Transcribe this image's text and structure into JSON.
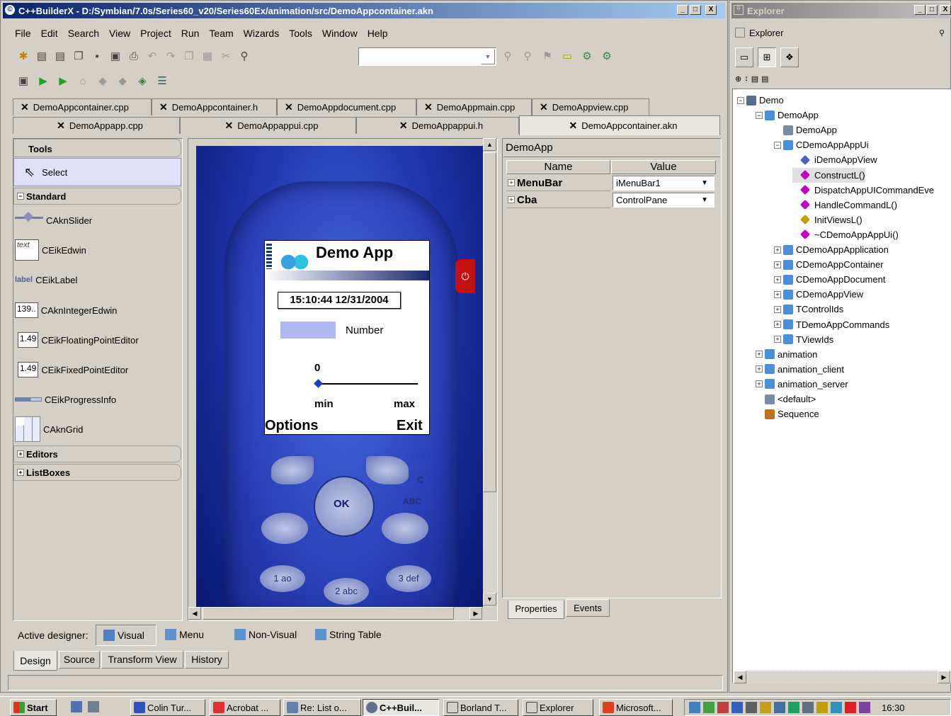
{
  "main_window": {
    "title": "C++BuilderX - D:/Symbian/7.0s/Series60_v20/Series60Ex/animation/src/DemoAppcontainer.akn",
    "controls": [
      "_",
      "□",
      "X"
    ]
  },
  "menu": [
    "File",
    "Edit",
    "Search",
    "View",
    "Project",
    "Run",
    "Team",
    "Wizards",
    "Tools",
    "Window",
    "Help"
  ],
  "editor_tabs_row1": [
    "DemoAppcontainer.cpp",
    "DemoAppcontainer.h",
    "DemoAppdocument.cpp",
    "DemoAppmain.cpp",
    "DemoAppview.cpp"
  ],
  "editor_tabs_row2": [
    "DemoAppapp.cpp",
    "DemoAppappui.cpp",
    "DemoAppappui.h",
    "DemoAppcontainer.akn"
  ],
  "palette": {
    "header": "Tools",
    "select": "Select",
    "standard_header": "Standard",
    "items": [
      {
        "icon": "slider-icon",
        "icon_text": "",
        "label": "CAknSlider"
      },
      {
        "icon": "edwin-icon",
        "icon_text": "text",
        "label": "CEikEdwin"
      },
      {
        "icon": "label-icon",
        "icon_text": "label",
        "label": "CEikLabel"
      },
      {
        "icon": "integer-edwin-icon",
        "icon_text": "139..",
        "label": "CAknIntegerEdwin"
      },
      {
        "icon": "floating-point-icon",
        "icon_text": "1.49",
        "label": "CEikFloatingPointEditor"
      },
      {
        "icon": "fixed-point-icon",
        "icon_text": "1.49",
        "label": "CEikFixedPointEditor"
      },
      {
        "icon": "progress-icon",
        "icon_text": "",
        "label": "CEikProgressInfo"
      },
      {
        "icon": "grid-icon",
        "icon_text": "",
        "label": "CAknGrid"
      }
    ],
    "editors_header": "Editors",
    "listboxes_header": "ListBoxes"
  },
  "phone_screen": {
    "title": "Demo App",
    "datetime": "15:10:44 12/31/2004",
    "number_label": "Number",
    "slider_value": "0",
    "slider_min": "min",
    "slider_max": "max",
    "softkey_left": "Options",
    "softkey_right": "Exit",
    "keys": {
      "ok": "OK",
      "c": "C",
      "abc": "ABC",
      "k1": "1 ao",
      "k2": "2 abc",
      "k3": "3 def"
    }
  },
  "inspector": {
    "title": "DemoApp",
    "col_name": "Name",
    "col_value": "Value",
    "rows": [
      {
        "name": "MenuBar",
        "value": "iMenuBar1"
      },
      {
        "name": "Cba",
        "value": "ControlPane"
      }
    ],
    "tab_properties": "Properties",
    "tab_events": "Events"
  },
  "designer": {
    "label": "Active designer:",
    "options": [
      "Visual",
      "Menu",
      "Non-Visual",
      "String Table"
    ]
  },
  "bottom_tabs": [
    "Design",
    "Source",
    "Transform View",
    "History"
  ],
  "explorer_window": {
    "title": "Explorer",
    "pane_title": "Explorer",
    "tree": [
      {
        "label": "Demo",
        "level": 0,
        "expander": "−",
        "color": "#5a6e8c"
      },
      {
        "label": "DemoApp",
        "level": 1,
        "expander": "−",
        "color": "#4a90d9"
      },
      {
        "label": "DemoApp",
        "level": 2,
        "expander": "",
        "color": "#7a8aa0"
      },
      {
        "label": "CDemoAppAppUi",
        "level": 2,
        "expander": "−",
        "color": "#4a90d9"
      },
      {
        "label": "iDemoAppView",
        "level": 3,
        "expander": "",
        "color": "#5060c0"
      },
      {
        "label": "ConstructL()",
        "level": 3,
        "expander": "",
        "color": "#c000c0"
      },
      {
        "label": "DispatchAppUICommandEve",
        "level": 3,
        "expander": "",
        "color": "#c000c0"
      },
      {
        "label": "HandleCommandL()",
        "level": 3,
        "expander": "",
        "color": "#c000c0"
      },
      {
        "label": "InitViewsL()",
        "level": 3,
        "expander": "",
        "color": "#c0a000"
      },
      {
        "label": "~CDemoAppAppUi()",
        "level": 3,
        "expander": "",
        "color": "#c000c0"
      },
      {
        "label": "CDemoAppApplication",
        "level": 2,
        "expander": "+",
        "color": "#4a90d9"
      },
      {
        "label": "CDemoAppContainer",
        "level": 2,
        "expander": "+",
        "color": "#4a90d9"
      },
      {
        "label": "CDemoAppDocument",
        "level": 2,
        "expander": "+",
        "color": "#4a90d9"
      },
      {
        "label": "CDemoAppView",
        "level": 2,
        "expander": "+",
        "color": "#4a90d9"
      },
      {
        "label": "TControlIds",
        "level": 2,
        "expander": "+",
        "color": "#4a90d9"
      },
      {
        "label": "TDemoAppCommands",
        "level": 2,
        "expander": "+",
        "color": "#4a90d9"
      },
      {
        "label": "TViewIds",
        "level": 2,
        "expander": "+",
        "color": "#4a90d9"
      },
      {
        "label": "animation",
        "level": 1,
        "expander": "+",
        "color": "#4a90d9"
      },
      {
        "label": "animation_client",
        "level": 1,
        "expander": "+",
        "color": "#4a90d9"
      },
      {
        "label": "animation_server",
        "level": 1,
        "expander": "+",
        "color": "#4a90d9"
      },
      {
        "label": "<default>",
        "level": 1,
        "expander": "",
        "color": "#7a8aa0"
      },
      {
        "label": "Sequence",
        "level": 1,
        "expander": "",
        "color": "#c07020"
      }
    ]
  },
  "taskbar": {
    "start": "Start",
    "buttons": [
      "Colin Tur...",
      "Acrobat ...",
      "Re: List o...",
      "C++Buil...",
      "Borland T...",
      "Explorer",
      "Microsoft..."
    ],
    "clock": "16:30"
  }
}
